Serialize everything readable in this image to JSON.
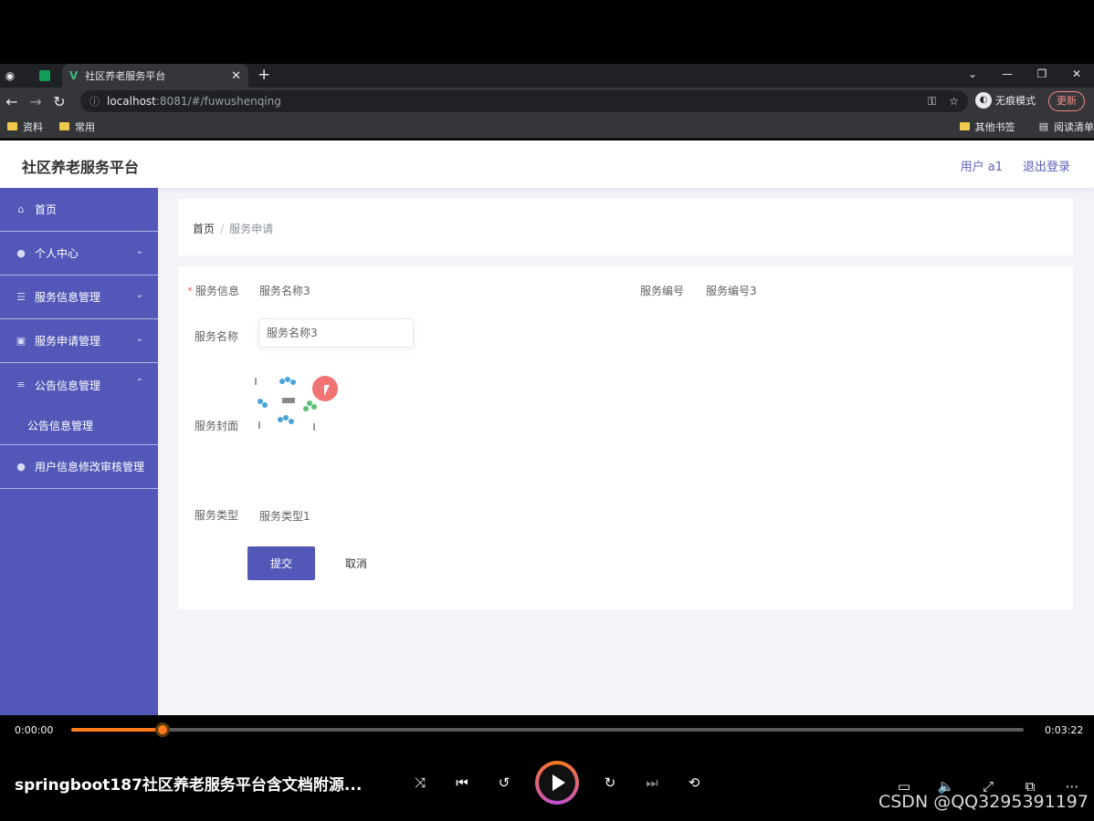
{
  "browser": {
    "tab_title": "社区养老服务平台",
    "url_host": "localhost",
    "url_path": ":8081/#/fuwushenqing",
    "incognito_label": "无痕模式",
    "update_label": "更新",
    "bookmarks": [
      "资料",
      "常用"
    ],
    "bookmarks_right": [
      "其他书签",
      "阅读清单"
    ]
  },
  "app": {
    "brand": "社区养老服务平台",
    "user_label": "用户 a1",
    "logout_label": "退出登录"
  },
  "sidebar": {
    "items": [
      {
        "label": "首页",
        "icon": "home-icon"
      },
      {
        "label": "个人中心",
        "icon": "user-icon"
      },
      {
        "label": "服务信息管理",
        "icon": "list-icon"
      },
      {
        "label": "服务申请管理",
        "icon": "clipboard-icon"
      },
      {
        "label": "公告信息管理",
        "icon": "menu-icon"
      },
      {
        "label": "公告信息管理"
      },
      {
        "label": "用户信息修改审核管理",
        "icon": "user-icon"
      }
    ]
  },
  "breadcrumb": {
    "home": "首页",
    "current": "服务申请"
  },
  "form": {
    "service_info_label": "服务信息",
    "service_info_value": "服务名称3",
    "service_no_label": "服务编号",
    "service_no_value": "服务编号3",
    "service_name_label": "服务名称",
    "service_name_value": "服务名称3",
    "cover_label": "服务封面",
    "type_label": "服务类型",
    "type_value": "服务类型1",
    "submit_label": "提交",
    "cancel_label": "取消"
  },
  "player": {
    "current_time": "0:00:00",
    "total_time": "0:03:22",
    "progress": 0.096,
    "title": "springboot187社区养老服务平台含文档附源...",
    "watermark": "CSDN @QQ3295391197",
    "accent_color": "#ff7a1a"
  }
}
